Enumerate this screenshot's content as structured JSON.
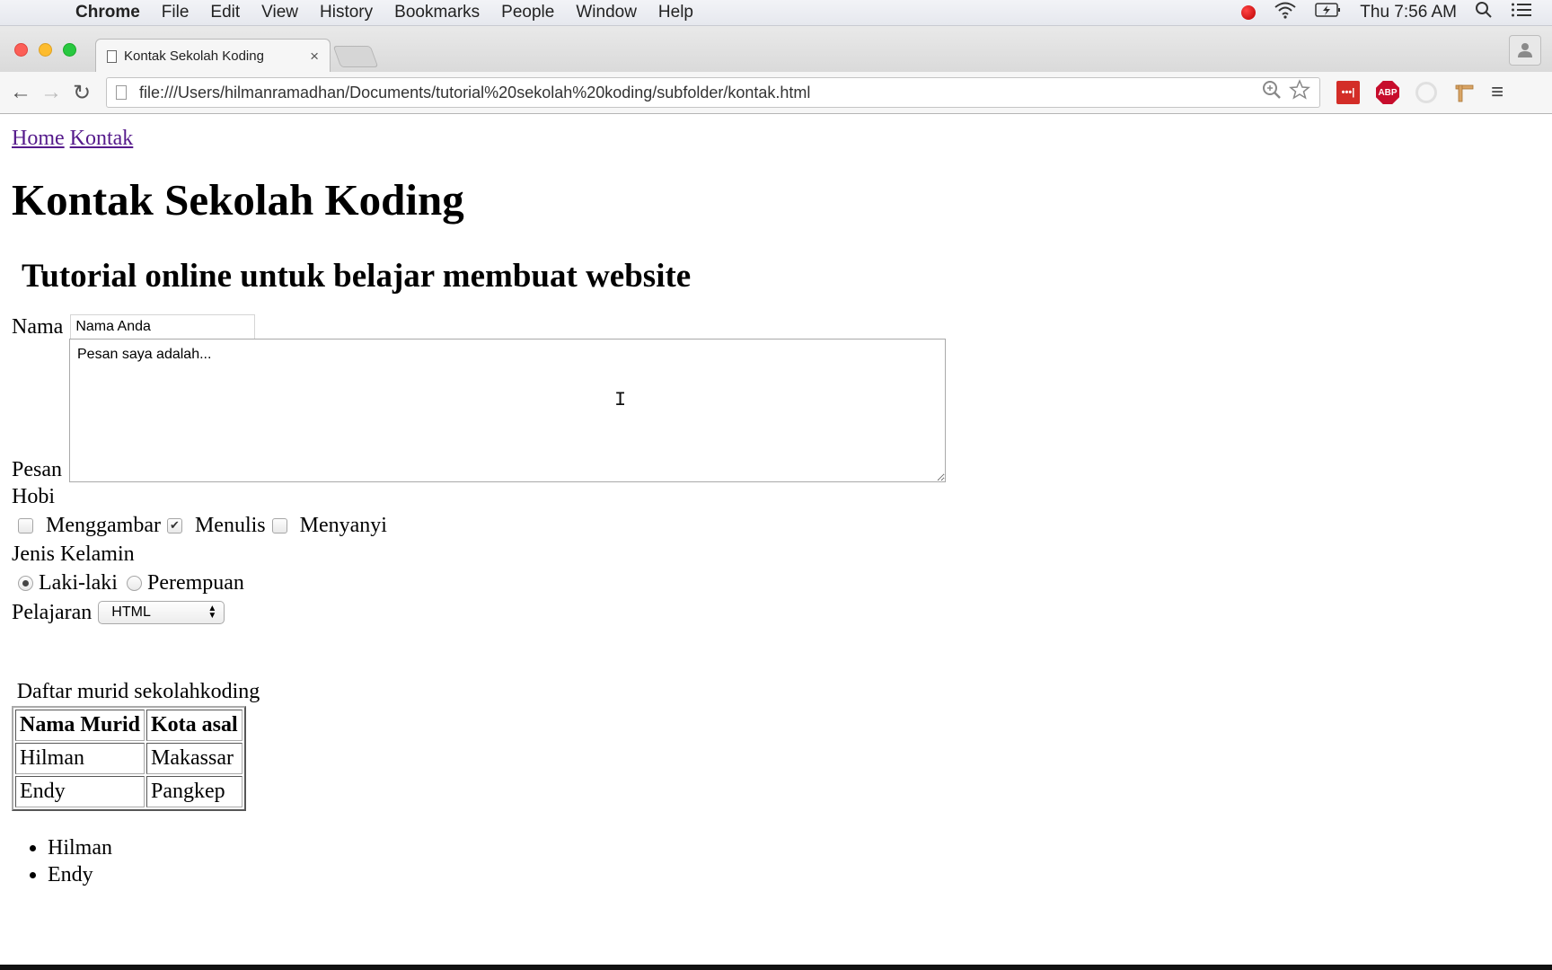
{
  "menubar": {
    "apple": "",
    "app": "Chrome",
    "items": [
      "File",
      "Edit",
      "View",
      "History",
      "Bookmarks",
      "People",
      "Window",
      "Help"
    ],
    "clock": "Thu 7:56 AM",
    "status_icons": [
      "record-icon",
      "wifi-icon",
      "battery-charging-icon",
      "spotlight-search-icon",
      "notification-center-icon"
    ]
  },
  "browser": {
    "tab_title": "Kontak Sekolah Koding",
    "tab_close": "×",
    "url": "file:///Users/hilmanramadhan/Documents/tutorial%20sekolah%20koding/subfolder/kontak.html",
    "nav": {
      "back": "←",
      "forward": "→",
      "reload": "↻"
    },
    "extensions": {
      "lastpass": "•••|",
      "abp": "ABP"
    },
    "menu": "≡",
    "profile": "👤"
  },
  "page": {
    "nav_links": [
      "Home",
      "Kontak"
    ],
    "heading": "Kontak Sekolah Koding",
    "subheading": "Tutorial online untuk belajar membuat website",
    "form": {
      "nama_label": "Nama",
      "nama_value": "Nama Anda",
      "pesan_label": "Pesan",
      "pesan_value": "Pesan saya adalah...",
      "hobi_label": "Hobi",
      "hobi_options": [
        {
          "label": "Menggambar",
          "checked": false
        },
        {
          "label": "Menulis",
          "checked": true
        },
        {
          "label": "Menyanyi",
          "checked": false
        }
      ],
      "gender_label": "Jenis Kelamin",
      "gender_options": [
        {
          "label": "Laki-laki",
          "selected": true
        },
        {
          "label": "Perempuan",
          "selected": false
        }
      ],
      "pelajaran_label": "Pelajaran",
      "pelajaran_value": "HTML"
    },
    "table": {
      "caption": "Daftar murid sekolahkoding",
      "headers": [
        "Nama Murid",
        "Kota asal"
      ],
      "rows": [
        [
          "Hilman",
          "Makassar"
        ],
        [
          "Endy",
          "Pangkep"
        ]
      ]
    },
    "list": [
      "Hilman",
      "Endy"
    ]
  }
}
